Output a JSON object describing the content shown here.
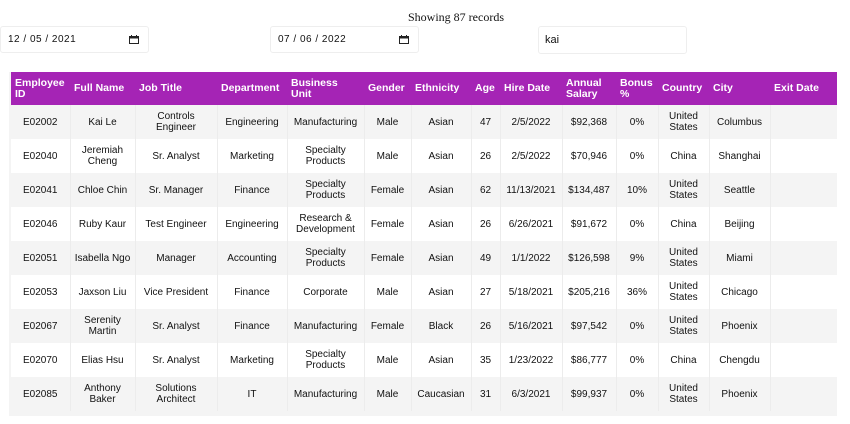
{
  "header": {
    "records_text": "Showing 87 records"
  },
  "filters": {
    "start_date": "12 / 05 / 2021",
    "end_date": "07 / 06 / 2022",
    "search_value": "kai"
  },
  "colors": {
    "header_bg": "#a524b5",
    "row_alt": "#f4f4f4"
  },
  "icons": {
    "date_picker": "calendar-icon"
  },
  "table": {
    "columns": [
      "Employee ID",
      "Full Name",
      "Job Title",
      "Department",
      "Business Unit",
      "Gender",
      "Ethnicity",
      "Age",
      "Hire Date",
      "Annual Salary",
      "Bonus %",
      "Country",
      "City",
      "Exit Date"
    ],
    "rows": [
      [
        "E02002",
        "Kai Le",
        "Controls Engineer",
        "Engineering",
        "Manufacturing",
        "Male",
        "Asian",
        "47",
        "2/5/2022",
        "$92,368",
        "0%",
        "United States",
        "Columbus",
        ""
      ],
      [
        "E02040",
        "Jeremiah Cheng",
        "Sr. Analyst",
        "Marketing",
        "Specialty Products",
        "Male",
        "Asian",
        "26",
        "2/5/2022",
        "$70,946",
        "0%",
        "China",
        "Shanghai",
        ""
      ],
      [
        "E02041",
        "Chloe Chin",
        "Sr. Manager",
        "Finance",
        "Specialty Products",
        "Female",
        "Asian",
        "62",
        "11/13/2021",
        "$134,487",
        "10%",
        "United States",
        "Seattle",
        ""
      ],
      [
        "E02046",
        "Ruby Kaur",
        "Test Engineer",
        "Engineering",
        "Research & Development",
        "Female",
        "Asian",
        "26",
        "6/26/2021",
        "$91,672",
        "0%",
        "China",
        "Beijing",
        ""
      ],
      [
        "E02051",
        "Isabella Ngo",
        "Manager",
        "Accounting",
        "Specialty Products",
        "Female",
        "Asian",
        "49",
        "1/1/2022",
        "$126,598",
        "9%",
        "United States",
        "Miami",
        ""
      ],
      [
        "E02053",
        "Jaxson Liu",
        "Vice President",
        "Finance",
        "Corporate",
        "Male",
        "Asian",
        "27",
        "5/18/2021",
        "$205,216",
        "36%",
        "United States",
        "Chicago",
        ""
      ],
      [
        "E02067",
        "Serenity Martin",
        "Sr. Analyst",
        "Finance",
        "Manufacturing",
        "Female",
        "Black",
        "26",
        "5/16/2021",
        "$97,542",
        "0%",
        "United States",
        "Phoenix",
        ""
      ],
      [
        "E02070",
        "Elias Hsu",
        "Sr. Analyst",
        "Marketing",
        "Specialty Products",
        "Male",
        "Asian",
        "35",
        "1/23/2022",
        "$86,777",
        "0%",
        "China",
        "Chengdu",
        ""
      ],
      [
        "E02085",
        "Anthony Baker",
        "Solutions Architect",
        "IT",
        "Manufacturing",
        "Male",
        "Caucasian",
        "31",
        "6/3/2021",
        "$99,937",
        "0%",
        "United States",
        "Phoenix",
        ""
      ]
    ]
  }
}
